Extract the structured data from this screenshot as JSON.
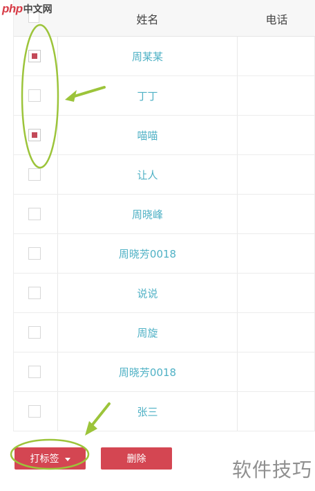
{
  "watermarks": {
    "top_php": "php",
    "top_site": "中文网",
    "bottom": "软件技巧"
  },
  "table": {
    "headers": {
      "name": "姓名",
      "phone": "电话"
    },
    "rows": [
      {
        "name": "周某某",
        "checked": true
      },
      {
        "name": "丁丁",
        "checked": false
      },
      {
        "name": "喵喵",
        "checked": true
      },
      {
        "name": "让人",
        "checked": false
      },
      {
        "name": "周晓峰",
        "checked": false
      },
      {
        "name": "周晓芳0018",
        "checked": false
      },
      {
        "name": "说说",
        "checked": false
      },
      {
        "name": "周旋",
        "checked": false
      },
      {
        "name": "周晓芳0018",
        "checked": false
      },
      {
        "name": "张三",
        "checked": false
      }
    ]
  },
  "buttons": {
    "tag": "打标签",
    "delete": "删除"
  },
  "colors": {
    "accent": "#d44652",
    "link": "#4fb1c5",
    "annotation": "#9cc43a"
  },
  "icons": {
    "dropdown": "chevron-down-icon"
  }
}
